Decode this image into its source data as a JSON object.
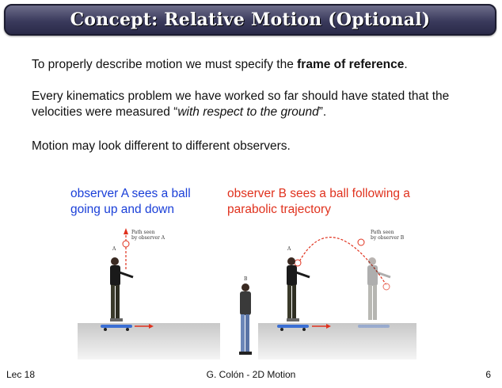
{
  "slide": {
    "title": "Concept: Relative Motion (Optional)",
    "p1_before": "To properly describe motion we must specify the ",
    "p1_bold": "frame of reference",
    "p1_after": ".",
    "p2_before": "Every kinematics problem we have worked so far should have stated that the velocities were measured “",
    "p2_italic": "with respect to the ground",
    "p2_after": "”.",
    "p3": "Motion may look different to different observers.",
    "observer_a_caption": "observer A sees a ball going up and down",
    "observer_b_caption": "observer B sees a ball following a parabolic trajectory"
  },
  "figure_a": {
    "path_label_line1": "Path seen",
    "path_label_line2": "by observer A",
    "person_label": "A"
  },
  "figure_b": {
    "path_label_line1": "Path seen",
    "path_label_line2": "by observer B",
    "person_a_label": "A",
    "person_b_label": "B"
  },
  "footer": {
    "left": "Lec 18",
    "center": "G. Colón  -  2D Motion",
    "right": "6"
  },
  "colors": {
    "observer_a": "#1a3fd8",
    "observer_b": "#e0321e",
    "path": "#e0321e",
    "title_bg": "#3a3a5c"
  }
}
